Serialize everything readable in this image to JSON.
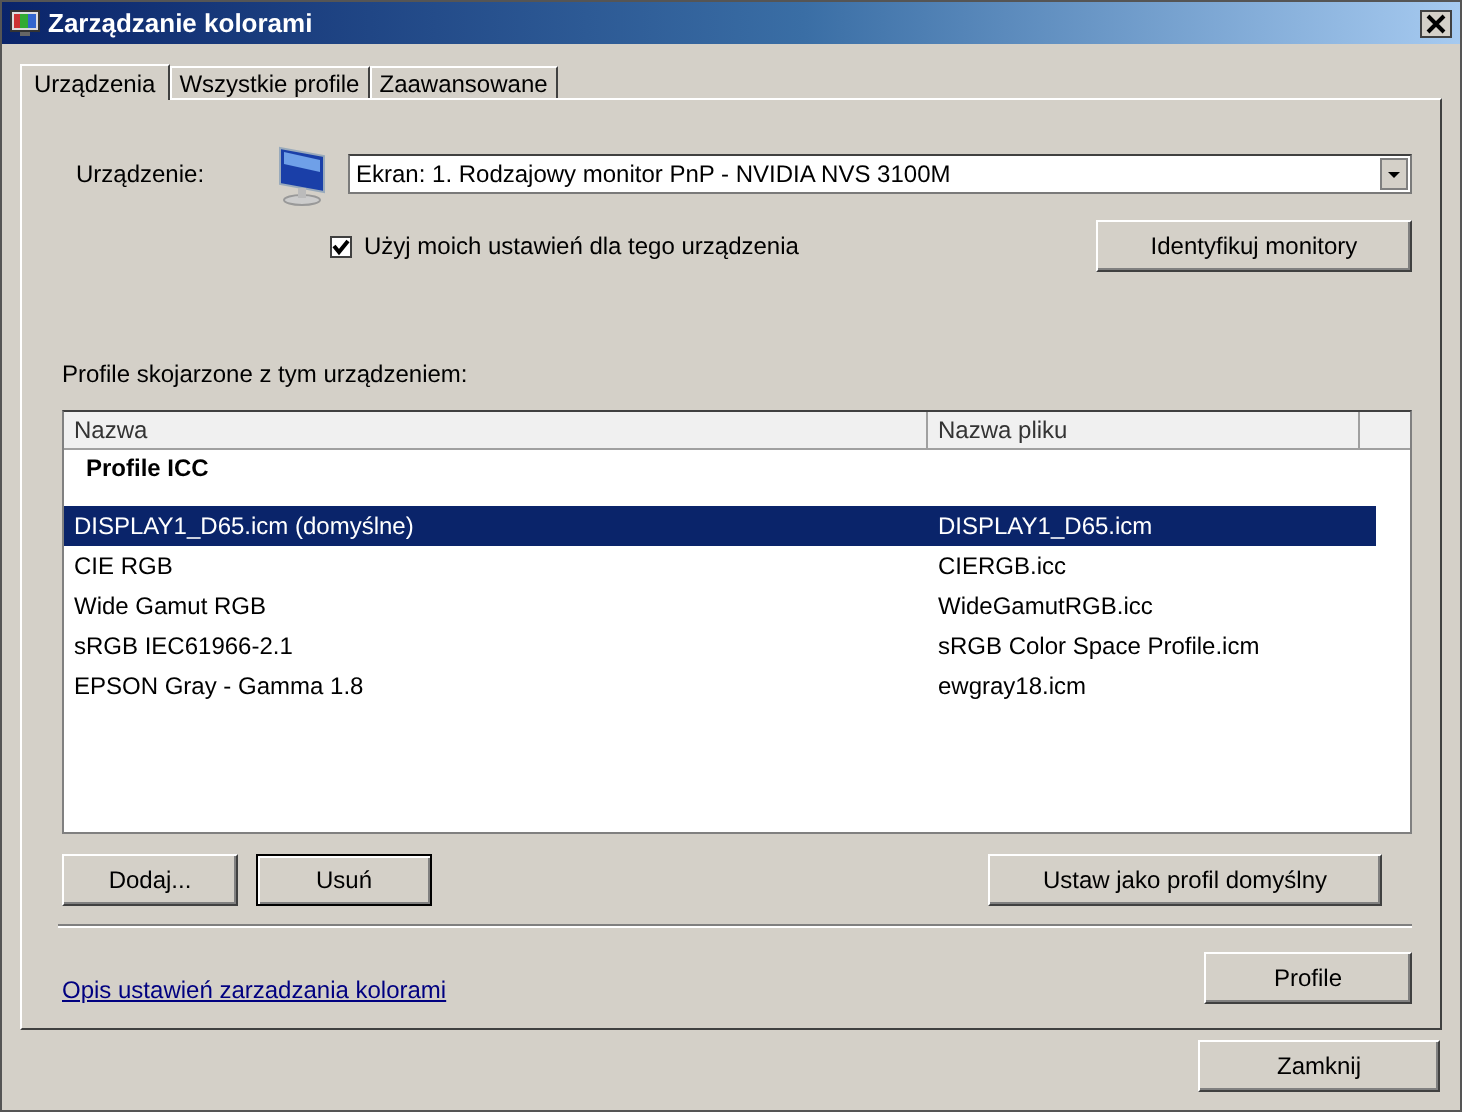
{
  "window": {
    "title": "Zarządzanie kolorami"
  },
  "tabs": [
    {
      "label": "Urządzenia",
      "selected": true
    },
    {
      "label": "Wszystkie profile",
      "selected": false
    },
    {
      "label": "Zaawansowane",
      "selected": false
    }
  ],
  "device": {
    "label": "Urządzenie:",
    "value": "Ekran: 1. Rodzajowy monitor PnP - NVIDIA NVS 3100M",
    "use_my_settings": {
      "label": "Użyj moich ustawień dla tego urządzenia",
      "checked": true
    },
    "identify_button": "Identyfikuj monitory"
  },
  "profiles": {
    "caption": "Profile skojarzone z tym urządzeniem:",
    "columns": [
      "Nazwa",
      "Nazwa pliku"
    ],
    "groups": [
      {
        "title": "Profile ICC",
        "rows": [
          {
            "name": "DISPLAY1_D65.icm (domyślne)",
            "file": "DISPLAY1_D65.icm",
            "selected": true
          },
          {
            "name": "CIE RGB",
            "file": "CIERGB.icc",
            "selected": false
          },
          {
            "name": "Wide Gamut RGB",
            "file": "WideGamutRGB.icc",
            "selected": false
          },
          {
            "name": "sRGB IEC61966-2.1",
            "file": "sRGB Color Space Profile.icm",
            "selected": false
          },
          {
            "name": "EPSON  Gray - Gamma 1.8",
            "file": "ewgray18.icm",
            "selected": false
          }
        ]
      }
    ]
  },
  "profile_buttons": {
    "add": "Dodaj...",
    "remove": "Usuń",
    "set_default": "Ustaw jako profil domyślny"
  },
  "link": "Opis ustawień zarzadzania kolorami",
  "profiles_button": "Profile",
  "close_button": "Zamknij"
}
